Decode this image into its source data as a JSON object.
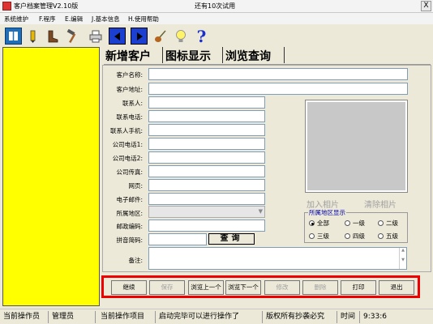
{
  "window": {
    "title": "客户档案管理V2.10版",
    "trial_notice": "还有10次试用",
    "close_symbol": "X"
  },
  "menu": [
    {
      "label": "系统维护"
    },
    {
      "label": "F.程序"
    },
    {
      "label": "E.编辑"
    },
    {
      "label": "J.基本信息"
    },
    {
      "label": "H.使用帮助"
    }
  ],
  "toolbar": [
    {
      "icon": "book-icon",
      "glyph": "📘"
    },
    {
      "icon": "pencil-icon",
      "glyph": "✏"
    },
    {
      "icon": "boots-icon",
      "glyph": "👢"
    },
    {
      "icon": "hammer-icon",
      "glyph": "🔨"
    },
    {
      "icon": "printer-icon",
      "glyph": "🖶"
    },
    {
      "icon": "prev-arrow-icon",
      "glyph": "◀"
    },
    {
      "icon": "next-arrow-icon",
      "glyph": "▶"
    },
    {
      "icon": "guitar-icon",
      "glyph": "🎸"
    },
    {
      "icon": "lightbulb-icon",
      "glyph": "💡"
    },
    {
      "icon": "help-icon",
      "glyph": "?"
    }
  ],
  "tabs": [
    {
      "label": "新增客户"
    },
    {
      "label": "图标显示"
    },
    {
      "label": "浏览查询"
    }
  ],
  "form": {
    "name_label": "客户名称:",
    "address_label": "客户地址:",
    "contact_label": "联系人:",
    "contact_phone_label": "联系电话:",
    "contact_mobile_label": "联系人手机:",
    "company_phone1_label": "公司电话1:",
    "company_phone2_label": "公司电话2:",
    "company_fax_label": "公司传真:",
    "website_label": "网页:",
    "email_label": "电子邮件:",
    "region_label": "所属地区:",
    "postcode_label": "邮政编码:",
    "pinyin_label": "拼音简码:",
    "memo_label": "备注:"
  },
  "photo": {
    "add_label": "加入相片",
    "clear_label": "清除相片"
  },
  "region_filter": {
    "title": "所属地区显示",
    "options": [
      {
        "label": "全部",
        "selected": true
      },
      {
        "label": "一级",
        "selected": false
      },
      {
        "label": "二级",
        "selected": false
      },
      {
        "label": "三级",
        "selected": false
      },
      {
        "label": "四级",
        "selected": false
      },
      {
        "label": "五级",
        "selected": false
      }
    ]
  },
  "query_button": "查询",
  "actions": [
    {
      "label": "继续",
      "enabled": true
    },
    {
      "label": "保存",
      "enabled": false
    },
    {
      "label": "浏览上一个",
      "enabled": true
    },
    {
      "label": "浏览下一个",
      "enabled": true
    },
    {
      "label": "修改",
      "enabled": false
    },
    {
      "label": "删除",
      "enabled": false
    },
    {
      "label": "打印",
      "enabled": true
    },
    {
      "label": "退出",
      "enabled": true
    }
  ],
  "status": {
    "operator_label": "当前操作员",
    "operator": "管理员",
    "project_label": "当前操作项目",
    "message": "启动完毕可以进行操作了",
    "copyright": "版权所有抄袭必究",
    "time_label": "时间",
    "time": "9:33:6"
  },
  "colors": {
    "left_panel": "#ffff00",
    "action_border": "#ee0000",
    "region_title": "#0000aa"
  }
}
